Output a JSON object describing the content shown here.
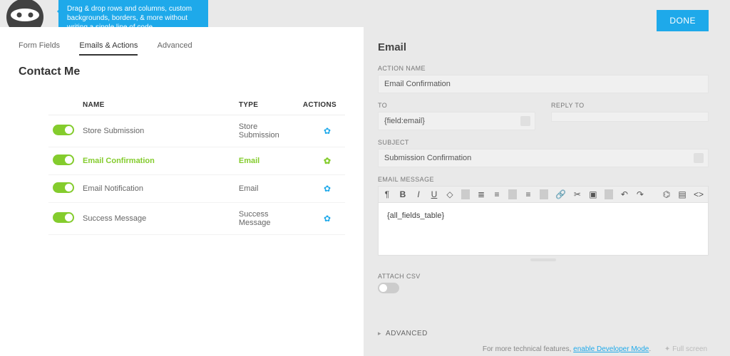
{
  "topbar": {
    "tip": "Drag & drop rows and columns, custom backgrounds, borders, & more without writing a single line of code.",
    "done": "DONE"
  },
  "tabs": {
    "form_fields": "Form Fields",
    "emails_actions": "Emails & Actions",
    "advanced": "Advanced"
  },
  "form_title": "Contact Me",
  "columns": {
    "name": "NAME",
    "type": "TYPE",
    "actions": "ACTIONS"
  },
  "actions": [
    {
      "name": "Store Submission",
      "type": "Store Submission",
      "active": false
    },
    {
      "name": "Email Confirmation",
      "type": "Email",
      "active": true
    },
    {
      "name": "Email Notification",
      "type": "Email",
      "active": false
    },
    {
      "name": "Success Message",
      "type": "Success Message",
      "active": false
    }
  ],
  "drawer": {
    "title": "Email",
    "action_name_lbl": "ACTION NAME",
    "action_name_val": "Email Confirmation",
    "to_lbl": "TO",
    "to_val": "{field:email}",
    "reply_to_lbl": "REPLY TO",
    "reply_to_val": "",
    "subject_lbl": "SUBJECT",
    "subject_val": "Submission Confirmation",
    "email_msg_lbl": "EMAIL MESSAGE",
    "email_msg_val": "{all_fields_table}",
    "attach_csv_lbl": "ATTACH CSV",
    "advanced_lbl": "ADVANCED"
  },
  "footer": {
    "text": "For more technical features, ",
    "link": "enable Developer Mode",
    "full": "Full screen"
  }
}
